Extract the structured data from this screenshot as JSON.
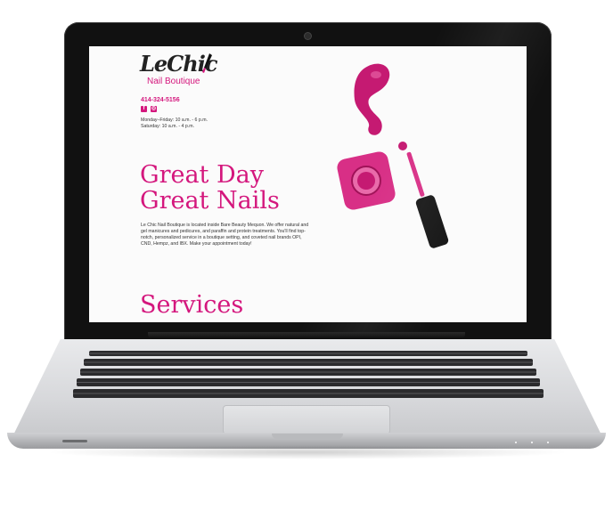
{
  "site": {
    "logo_script": "LeChic",
    "logo_sub": "Nail Boutique",
    "phone": "414-324-5156",
    "social_icons": [
      "facebook-icon",
      "instagram-icon"
    ],
    "hours": [
      "Monday–Friday: 10 a.m. - 6 p.m.",
      "Saturday: 10 a.m. - 4 p.m."
    ],
    "headline_line1": "Great Day",
    "headline_line2": "Great Nails",
    "intro": "Le Chic Nail Boutique is located inside Bare Beauty Mequon. We offer natural and gel manicures and pedicures, and paraffin and protein treatments. You'll find top-notch, personalized service in a boutique setting, and coveted nail brands OPI, CND, Hempz, and IBX. Make your appointment today!",
    "services_heading": "Services"
  },
  "colors": {
    "brand": "#d4177d",
    "text": "#333333",
    "bezel": "#111111",
    "body": "#d7d8db"
  }
}
